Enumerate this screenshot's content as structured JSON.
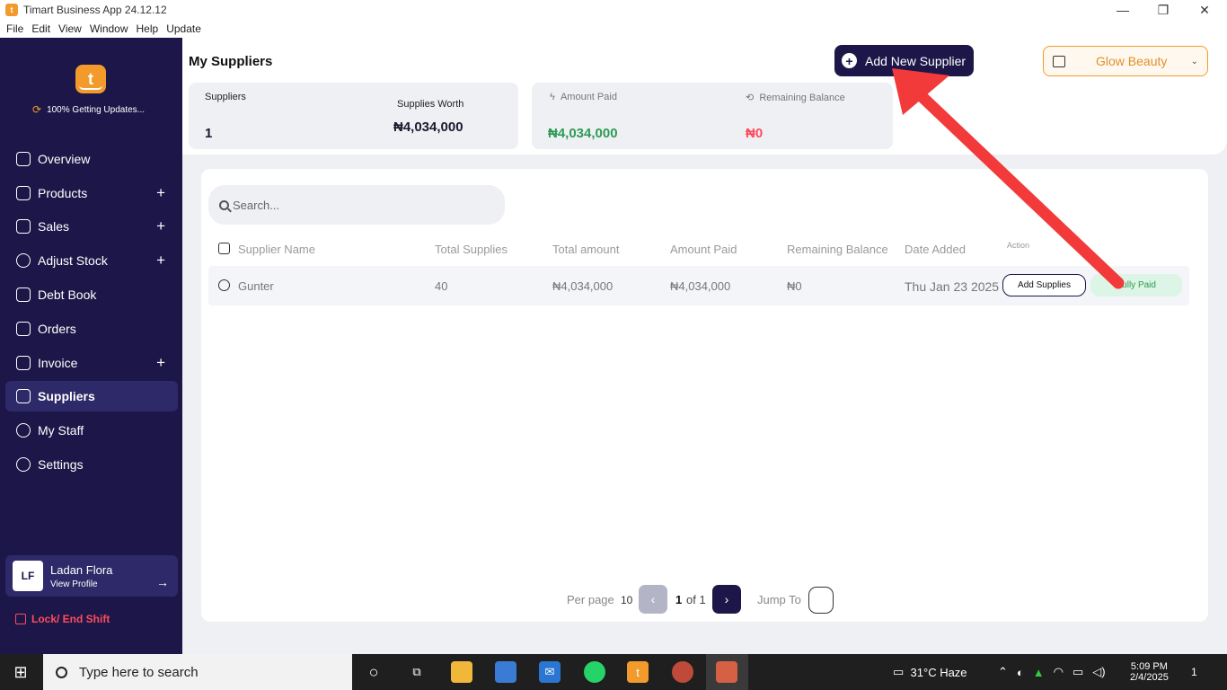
{
  "window": {
    "title": "Timart Business App 24.12.12",
    "controls": [
      "minimize-icon",
      "restore-icon",
      "close-icon"
    ]
  },
  "menu": [
    "File",
    "Edit",
    "View",
    "Window",
    "Help",
    "Update"
  ],
  "sidebar": {
    "logo_letter": "t",
    "update_status": "100%  Getting Updates...",
    "items": [
      {
        "label": "Overview",
        "icon": "overview-icon",
        "plus": false
      },
      {
        "label": "Products",
        "icon": "box-icon",
        "plus": true
      },
      {
        "label": "Sales",
        "icon": "cart-icon",
        "plus": true
      },
      {
        "label": "Adjust Stock",
        "icon": "adjust-icon",
        "plus": true
      },
      {
        "label": "Debt Book",
        "icon": "book-icon",
        "plus": false
      },
      {
        "label": "Orders",
        "icon": "clipboard-icon",
        "plus": false
      },
      {
        "label": "Invoice",
        "icon": "invoice-icon",
        "plus": true
      },
      {
        "label": "Suppliers",
        "icon": "id-card-icon",
        "plus": false,
        "active": true
      },
      {
        "label": "My Staff",
        "icon": "people-icon",
        "plus": false
      },
      {
        "label": "Settings",
        "icon": "gear-icon",
        "plus": false
      }
    ],
    "plus_symbol": "+",
    "profile": {
      "initials": "LF",
      "name": "Ladan Flora",
      "link": "View Profile",
      "arrow": "→"
    },
    "lock": "Lock/ End Shift"
  },
  "header": {
    "title": "My Suppliers",
    "add_button": "Add New Supplier",
    "add_symbol": "+",
    "store": "Glow Beauty",
    "chevron": "⌄"
  },
  "stats": {
    "suppliers_label": "Suppliers",
    "suppliers_value": "1",
    "worth_label": "Supplies Worth",
    "worth_value": "₦4,034,000",
    "paid_label": "Amount Paid",
    "paid_value": "₦4,034,000",
    "remaining_label": "Remaining Balance",
    "remaining_value": "₦0",
    "colors": {
      "paid": "#2e9a55",
      "remaining": "#ff4b5c"
    }
  },
  "table": {
    "search_placeholder": "Search...",
    "columns": [
      "Supplier Name",
      "Total Supplies",
      "Total amount",
      "Amount Paid",
      "Remaining Balance",
      "Date Added",
      "Action"
    ],
    "rows": [
      {
        "name": "Gunter",
        "total_supplies": "40",
        "total_amount": "₦4,034,000",
        "amount_paid": "₦4,034,000",
        "remaining": "₦0",
        "date": "Thu Jan 23 2025",
        "action": "Add Supplies",
        "status": "Fully Paid"
      }
    ]
  },
  "pagination": {
    "per_page_label": "Per page",
    "per_page": "10",
    "prev": "‹",
    "next": "›",
    "current": "1",
    "of_total": "of 1",
    "jump_label": "Jump To"
  },
  "taskbar": {
    "search_placeholder": "Type here to search",
    "weather": "31°C  Haze",
    "time": "5:09 PM",
    "date": "2/4/2025",
    "notifications": "1"
  }
}
